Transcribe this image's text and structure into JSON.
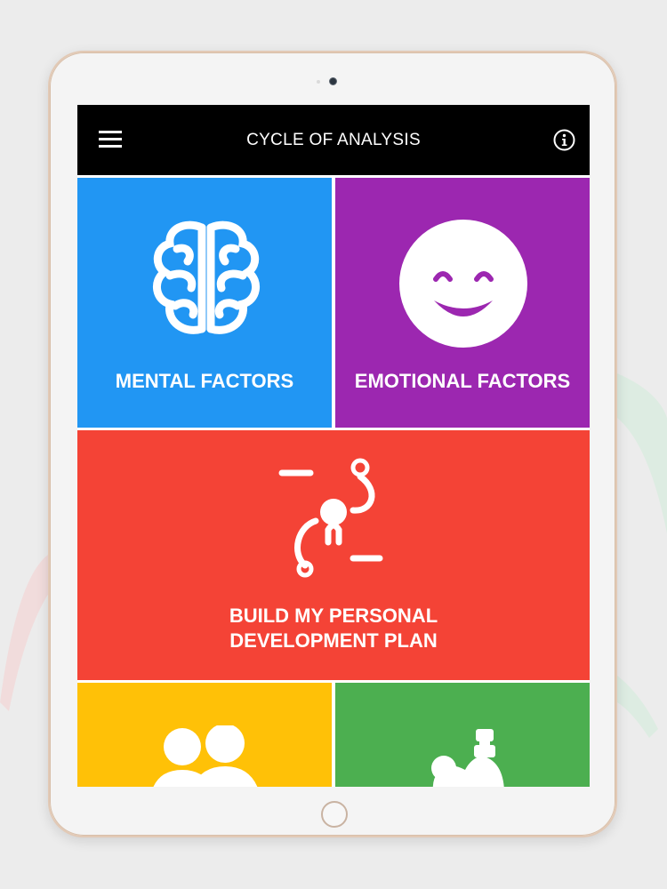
{
  "app": {
    "title": "CYCLE OF ANALYSIS",
    "menu_icon": "hamburger-menu-icon",
    "info_icon": "info-circle-icon"
  },
  "tiles": [
    {
      "label": "MENTAL FACTORS",
      "icon": "brain-icon",
      "color": "#2196f3"
    },
    {
      "label": "EMOTIONAL FACTORS",
      "icon": "smiley-face-icon",
      "color": "#9c27b0"
    },
    {
      "label_line1": "BUILD MY PERSONAL",
      "label_line2": "DEVELOPMENT PLAN",
      "icon": "development-path-icon",
      "color": "#f44336"
    },
    {
      "label": "",
      "icon": "people-icon",
      "color": "#ffc107"
    },
    {
      "label": "",
      "icon": "muscle-arm-icon",
      "color": "#4caf50"
    }
  ],
  "colors": {
    "appbar": "#000000",
    "tablet_frame": "#f4f4f4",
    "tablet_rim": "#e2c9b5"
  }
}
